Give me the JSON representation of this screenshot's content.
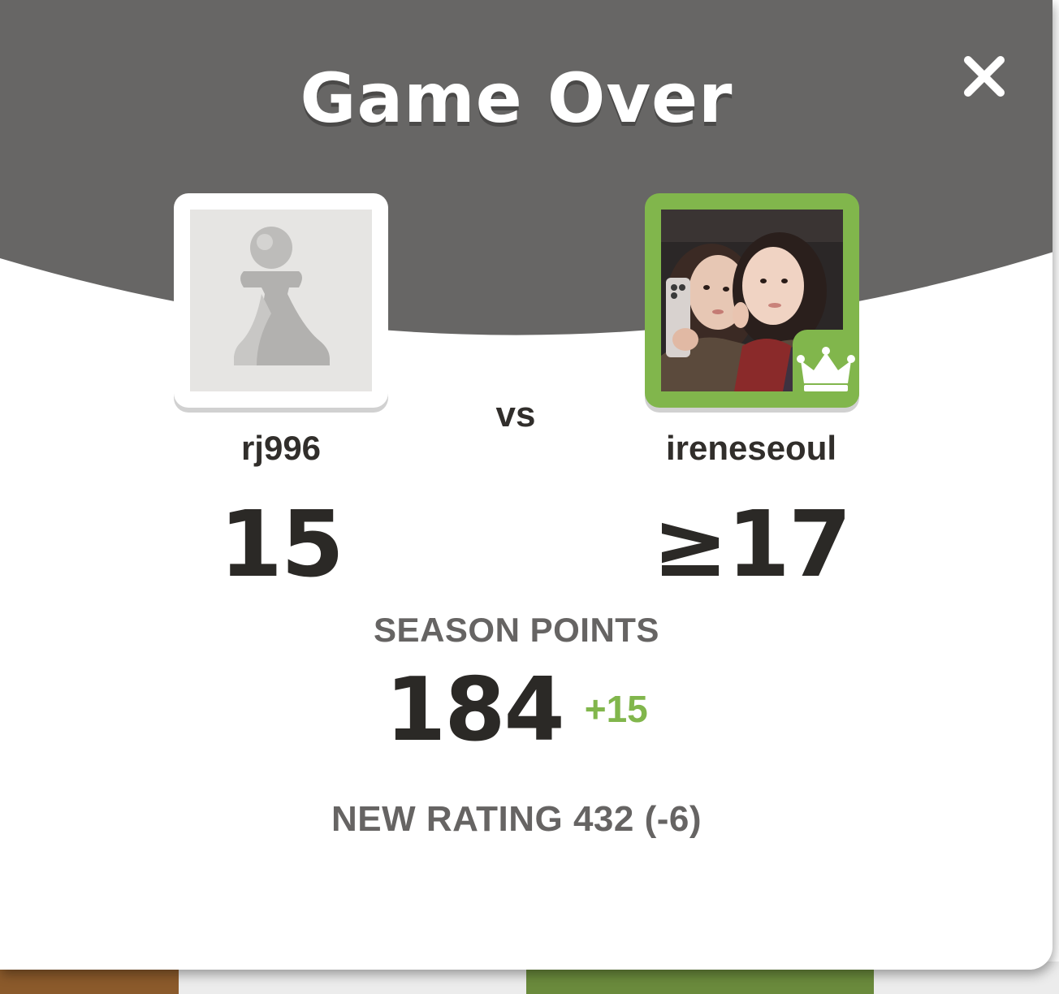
{
  "dialog": {
    "title": "Game Over",
    "close_icon": "close-icon"
  },
  "players": {
    "left": {
      "username": "rj996",
      "score": "15",
      "avatar_icon": "pawn-icon"
    },
    "vs_label": "vs",
    "right": {
      "username": "ireneseoul",
      "score": "≥17",
      "avatar": "profile-photo",
      "badge_icon": "crown-icon"
    }
  },
  "season": {
    "label": "SEASON POINTS",
    "value": "184",
    "delta": "+15"
  },
  "rating": {
    "text": "NEW RATING 432 (-6)"
  },
  "colors": {
    "header": "#676665",
    "accent_green": "#81b64c",
    "text_dark": "#2b2926",
    "text_gray": "#666463"
  }
}
